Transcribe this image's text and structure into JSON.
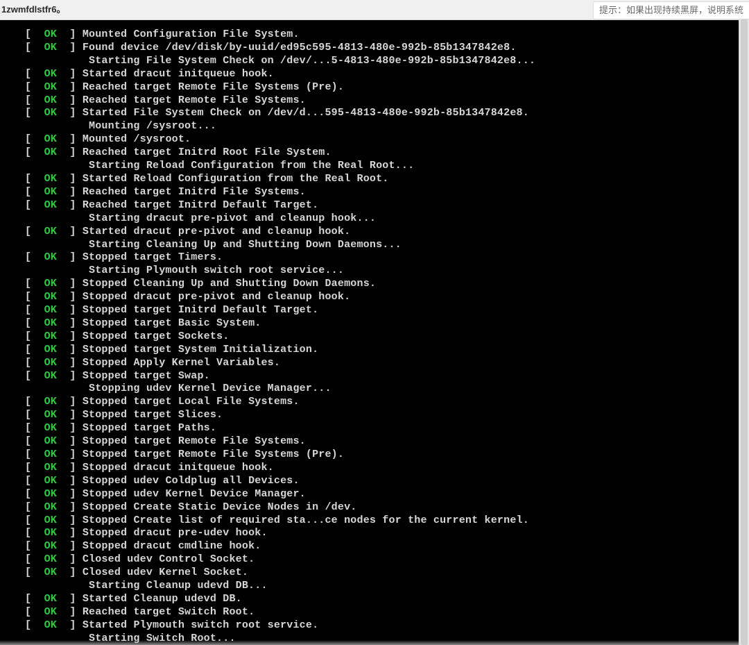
{
  "header": {
    "hostname": "1zwmfdlstfr6。",
    "hint": "提示：如果出现持续黑屏，说明系统"
  },
  "console": {
    "indent": "          ",
    "lines": [
      {
        "status": "OK",
        "text": "Mounted Configuration File System."
      },
      {
        "status": "OK",
        "text": "Found device /dev/disk/by-uuid/ed95c595-4813-480e-992b-85b1347842e8."
      },
      {
        "status": null,
        "text": "Starting File System Check on /dev/...5-4813-480e-992b-85b1347842e8..."
      },
      {
        "status": "OK",
        "text": "Started dracut initqueue hook."
      },
      {
        "status": "OK",
        "text": "Reached target Remote File Systems (Pre)."
      },
      {
        "status": "OK",
        "text": "Reached target Remote File Systems."
      },
      {
        "status": "OK",
        "text": "Started File System Check on /dev/d...595-4813-480e-992b-85b1347842e8."
      },
      {
        "status": null,
        "text": "Mounting /sysroot..."
      },
      {
        "status": "OK",
        "text": "Mounted /sysroot."
      },
      {
        "status": "OK",
        "text": "Reached target Initrd Root File System."
      },
      {
        "status": null,
        "text": "Starting Reload Configuration from the Real Root..."
      },
      {
        "status": "OK",
        "text": "Started Reload Configuration from the Real Root."
      },
      {
        "status": "OK",
        "text": "Reached target Initrd File Systems."
      },
      {
        "status": "OK",
        "text": "Reached target Initrd Default Target."
      },
      {
        "status": null,
        "text": "Starting dracut pre-pivot and cleanup hook..."
      },
      {
        "status": "OK",
        "text": "Started dracut pre-pivot and cleanup hook."
      },
      {
        "status": null,
        "text": "Starting Cleaning Up and Shutting Down Daemons..."
      },
      {
        "status": "OK",
        "text": "Stopped target Timers."
      },
      {
        "status": null,
        "text": "Starting Plymouth switch root service..."
      },
      {
        "status": "OK",
        "text": "Stopped Cleaning Up and Shutting Down Daemons."
      },
      {
        "status": "OK",
        "text": "Stopped dracut pre-pivot and cleanup hook."
      },
      {
        "status": "OK",
        "text": "Stopped target Initrd Default Target."
      },
      {
        "status": "OK",
        "text": "Stopped target Basic System."
      },
      {
        "status": "OK",
        "text": "Stopped target Sockets."
      },
      {
        "status": "OK",
        "text": "Stopped target System Initialization."
      },
      {
        "status": "OK",
        "text": "Stopped Apply Kernel Variables."
      },
      {
        "status": "OK",
        "text": "Stopped target Swap."
      },
      {
        "status": null,
        "text": "Stopping udev Kernel Device Manager..."
      },
      {
        "status": "OK",
        "text": "Stopped target Local File Systems."
      },
      {
        "status": "OK",
        "text": "Stopped target Slices."
      },
      {
        "status": "OK",
        "text": "Stopped target Paths."
      },
      {
        "status": "OK",
        "text": "Stopped target Remote File Systems."
      },
      {
        "status": "OK",
        "text": "Stopped target Remote File Systems (Pre)."
      },
      {
        "status": "OK",
        "text": "Stopped dracut initqueue hook."
      },
      {
        "status": "OK",
        "text": "Stopped udev Coldplug all Devices."
      },
      {
        "status": "OK",
        "text": "Stopped udev Kernel Device Manager."
      },
      {
        "status": "OK",
        "text": "Stopped Create Static Device Nodes in /dev."
      },
      {
        "status": "OK",
        "text": "Stopped Create list of required sta...ce nodes for the current kernel."
      },
      {
        "status": "OK",
        "text": "Stopped dracut pre-udev hook."
      },
      {
        "status": "OK",
        "text": "Stopped dracut cmdline hook."
      },
      {
        "status": "OK",
        "text": "Closed udev Control Socket."
      },
      {
        "status": "OK",
        "text": "Closed udev Kernel Socket."
      },
      {
        "status": null,
        "text": "Starting Cleanup udevd DB..."
      },
      {
        "status": "OK",
        "text": "Started Cleanup udevd DB."
      },
      {
        "status": "OK",
        "text": "Reached target Switch Root."
      },
      {
        "status": "OK",
        "text": "Started Plymouth switch root service."
      },
      {
        "status": null,
        "text": "Starting Switch Root..."
      }
    ]
  }
}
